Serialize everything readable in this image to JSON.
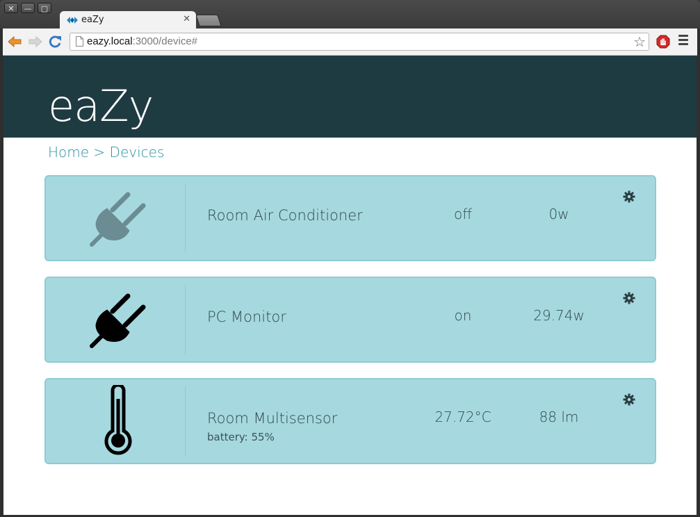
{
  "browser": {
    "window_buttons": [
      "✕",
      "—",
      "▢"
    ],
    "tab": {
      "title": "eaZy",
      "close": "✕"
    },
    "url": {
      "host": "eazy.local",
      "rest": ":3000/device#"
    },
    "back_glyph": "🡐",
    "forward_glyph": "🡒",
    "reload_glyph": "↻",
    "star_glyph": "☆"
  },
  "app": {
    "brand": "eaZy",
    "breadcrumb": {
      "home": "Home",
      "separator": " > ",
      "current": "Devices"
    }
  },
  "colors": {
    "banner": "#1f3b42",
    "card_bg": "#a6d8df",
    "link": "#2a8e9e",
    "plug_off": "#6b8c92",
    "plug_on": "#000000"
  },
  "devices": [
    {
      "name": "Room Air Conditioner",
      "state": "off",
      "value": "0w",
      "icon": "plug-icon",
      "active": false
    },
    {
      "name": "PC Monitor",
      "state": "on",
      "value": "29.74w",
      "icon": "plug-icon",
      "active": true
    },
    {
      "name": "Room Multisensor",
      "subtitle": "battery: 55%",
      "state": "27.72°C",
      "value": "88 lm",
      "icon": "thermometer-icon",
      "active": true
    }
  ]
}
